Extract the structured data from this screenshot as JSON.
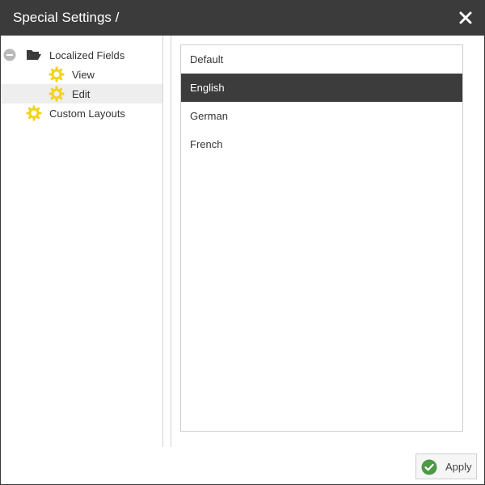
{
  "dialog": {
    "title": "Special Settings /",
    "close_icon": "close-icon"
  },
  "tree": {
    "items": [
      {
        "label": "Localized Fields",
        "icon": "folder-open-icon",
        "toggle": "collapse-icon",
        "expanded": true,
        "selected": false
      },
      {
        "label": "View",
        "icon": "gear-icon",
        "selected": false
      },
      {
        "label": "Edit",
        "icon": "gear-icon",
        "selected": true
      },
      {
        "label": "Custom Layouts",
        "icon": "gear-icon",
        "selected": false
      }
    ]
  },
  "languages": {
    "items": [
      {
        "label": "Default",
        "selected": false
      },
      {
        "label": "English",
        "selected": true
      },
      {
        "label": "German",
        "selected": false
      },
      {
        "label": "French",
        "selected": false
      }
    ]
  },
  "footer": {
    "apply_label": "Apply",
    "apply_icon": "check-circle-icon"
  },
  "colors": {
    "titlebar": "#3b3b3b",
    "selected_list_item": "#3c3c3c",
    "gear": "#f2d31b",
    "apply_check": "#4c9a46"
  }
}
